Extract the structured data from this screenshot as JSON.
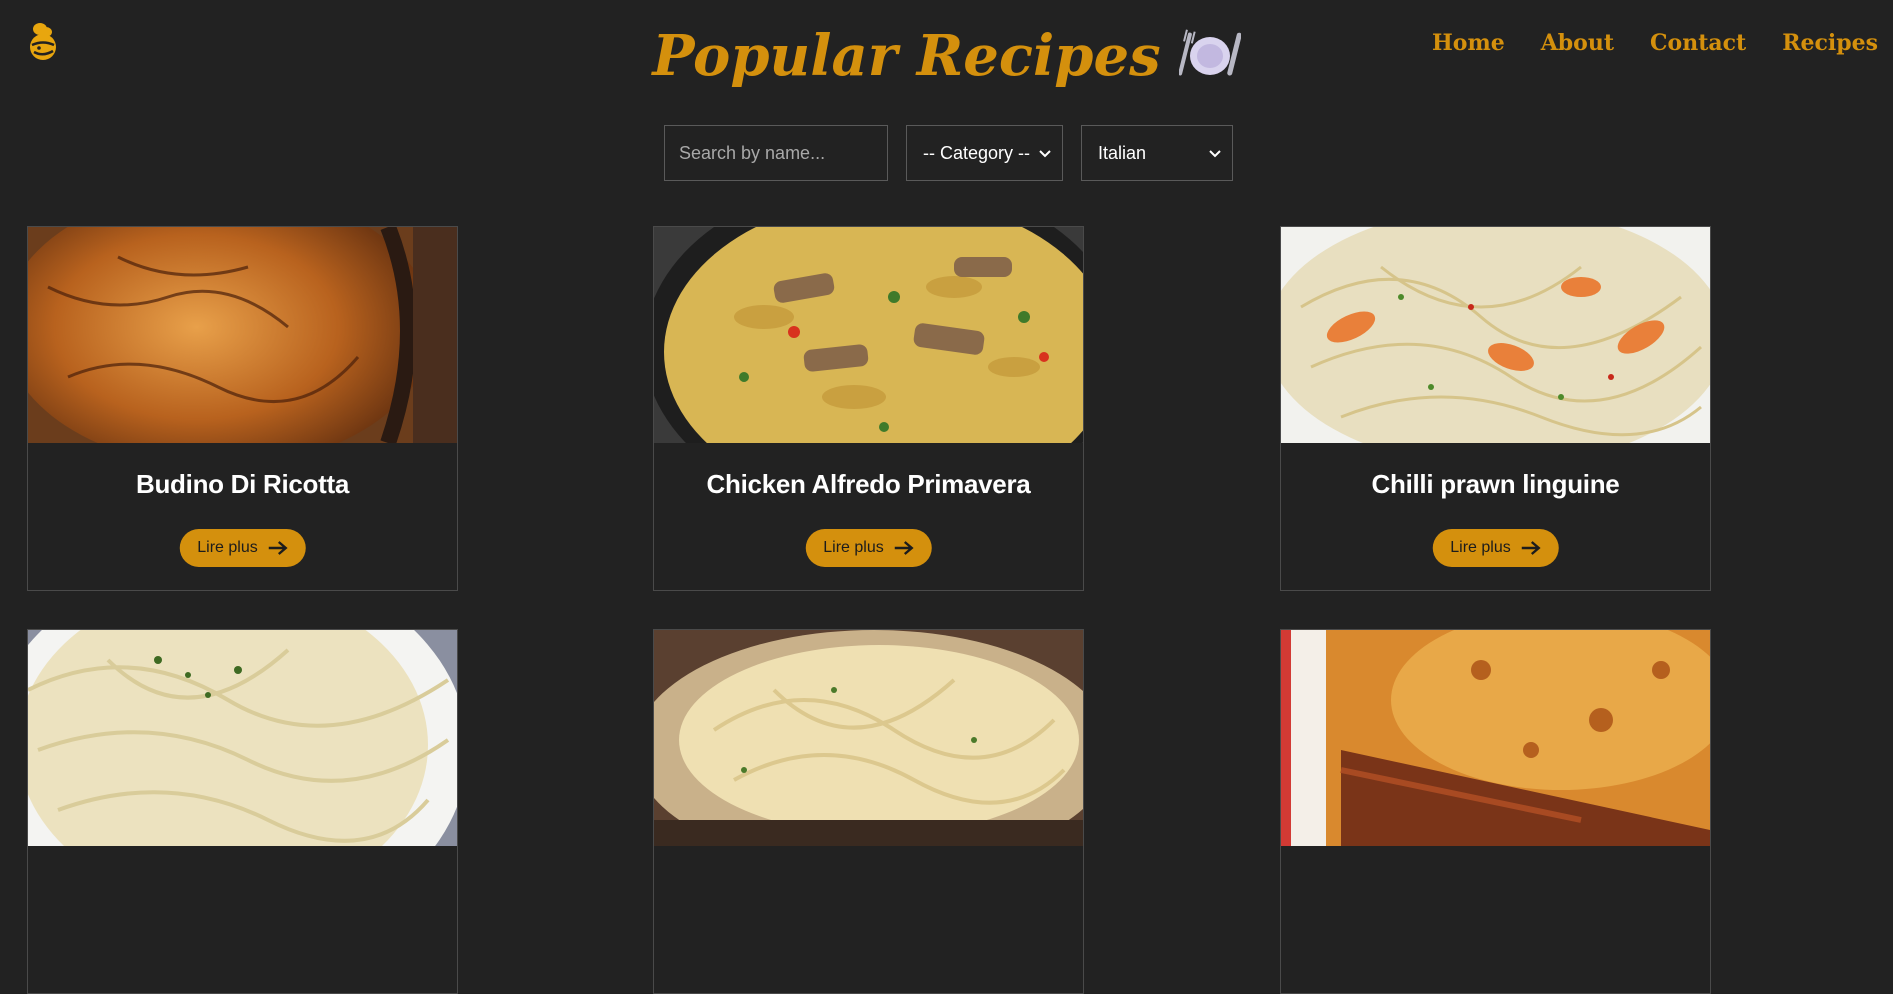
{
  "header": {
    "title": "Popular Recipes",
    "logo_icon": "chef-logo-icon",
    "title_icon": "fork-knife-plate-icon",
    "accent_color": "#D4900D"
  },
  "nav": {
    "items": [
      {
        "label": "Home"
      },
      {
        "label": "About"
      },
      {
        "label": "Contact"
      },
      {
        "label": "Recipes"
      }
    ]
  },
  "filters": {
    "search_placeholder": "Search by name...",
    "search_value": "",
    "category_selected": "-- Category --",
    "area_selected": "Italian"
  },
  "recipes": [
    {
      "name": "Budino Di Ricotta",
      "button_label": "Lire plus"
    },
    {
      "name": "Chicken Alfredo Primavera",
      "button_label": "Lire plus"
    },
    {
      "name": "Chilli prawn linguine",
      "button_label": "Lire plus"
    },
    {
      "name": "",
      "button_label": ""
    },
    {
      "name": "",
      "button_label": ""
    },
    {
      "name": "",
      "button_label": ""
    }
  ]
}
